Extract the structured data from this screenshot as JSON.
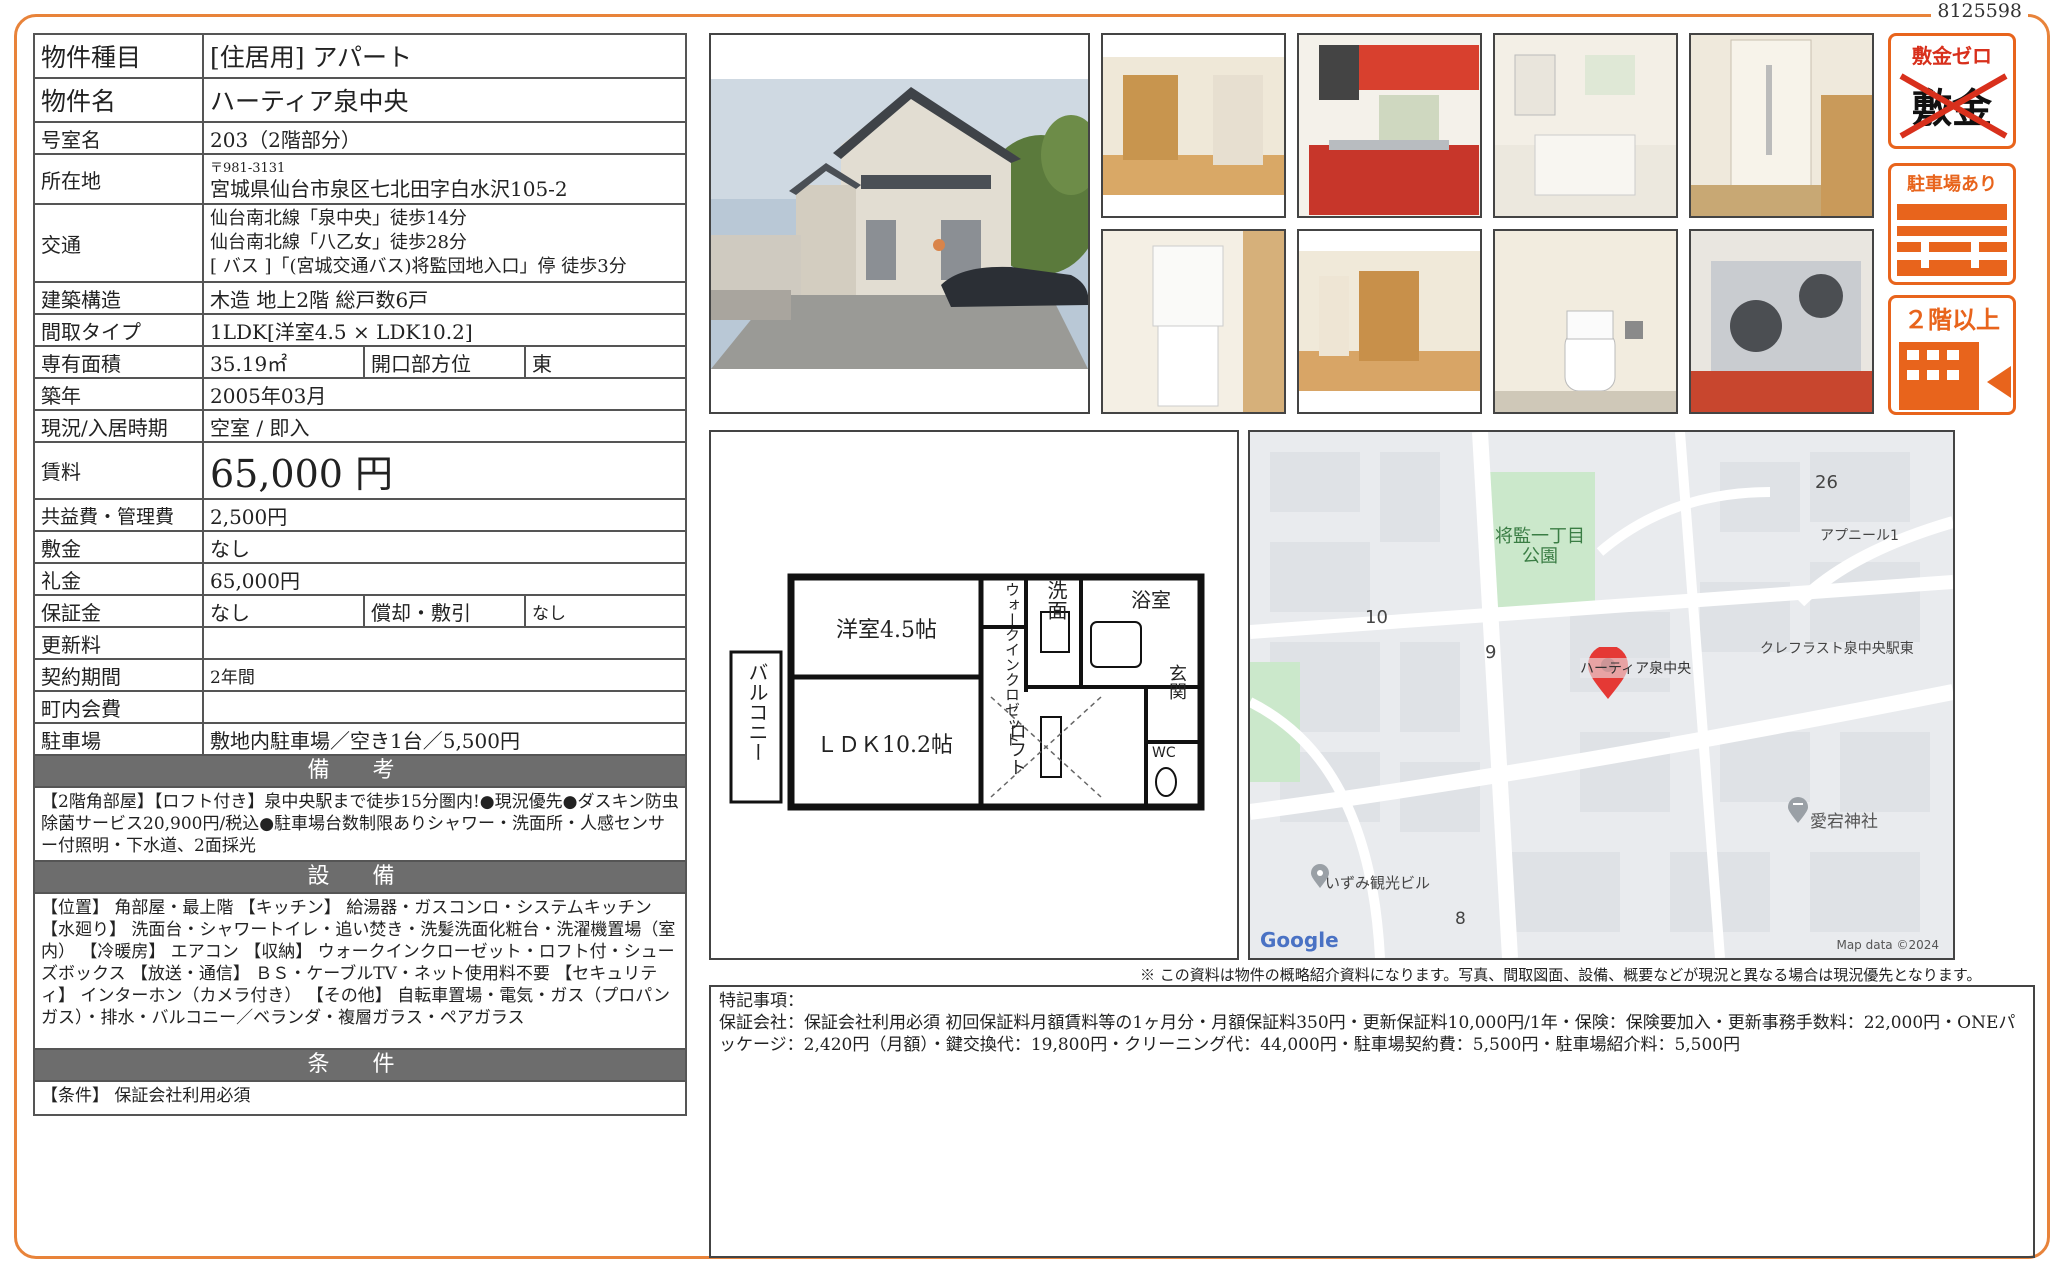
{
  "doc_id": "8125598",
  "spec": {
    "type_label": "物件種目",
    "type_value": "[住居用] アパート",
    "name_label": "物件名",
    "name_value": "ハーティア泉中央",
    "room_label": "号室名",
    "room_value": "203（2階部分）",
    "address_label": "所在地",
    "postal": "〒981-3131",
    "address": "宮城県仙台市泉区七北田字白水沢105-2",
    "transport_label": "交通",
    "transport": [
      "仙台南北線「泉中央」徒歩14分",
      "仙台南北線「八乙女」徒歩28分",
      "[ バス ]「(宮城交通バス)将監団地入口」停 徒歩3分"
    ],
    "structure_label": "建築構造",
    "structure_value": "木造 地上2階 総戸数6戸",
    "layout_label": "間取タイプ",
    "layout_value": "1LDK[洋室4.5 × LDK10.2]",
    "area_label": "専有面積",
    "area_value": "35.19㎡",
    "direction_label": "開口部方位",
    "direction_value": "東",
    "built_label": "築年",
    "built_value": "2005年03月",
    "status_label": "現況/入居時期",
    "status_value": "空室 / 即入",
    "rent_label": "賃料",
    "rent_value": "65,000 円",
    "fee_label": "共益費・管理費",
    "fee_value": "2,500円",
    "deposit_label": "敷金",
    "deposit_value": "なし",
    "keymoney_label": "礼金",
    "keymoney_value": "65,000円",
    "guarantee_label": "保証金",
    "guarantee_value": "なし",
    "amort_label": "償却・敷引",
    "amort_value": "なし",
    "renewal_label": "更新料",
    "renewal_value": "",
    "contract_label": "契約期間",
    "contract_value": "2年間",
    "assoc_label": "町内会費",
    "assoc_value": "",
    "parking_label": "駐車場",
    "parking_value": "敷地内駐車場／空き1台／5,500円"
  },
  "remarks": {
    "title": "備 考",
    "text": "【2階角部屋】【ロフト付き】泉中央駅まで徒歩15分圏内!●現況優先●ダスキン防虫除菌サービス20,900円/税込●駐車場台数制限ありシャワー・洗面所・人感センサー付照明・下水道、2面採光"
  },
  "equipment": {
    "title": "設 備",
    "text": "【位置】 角部屋・最上階 【キッチン】 給湯器・ガスコンロ・システムキッチン 【水廻り】 洗面台・シャワートイレ・追い焚き・洗髪洗面化粧台・洗濯機置場（室内） 【冷暖房】 エアコン 【収納】 ウォークインクローゼット・ロフト付・シューズボックス 【放送・通信】 ＢＳ・ケーブルTV・ネット使用料不要 【セキュリティ】 インターホン（カメラ付き） 【その他】 自転車置場・電気・ガス（プロパンガス）・排水・バルコニー／ベランダ・複層ガラス・ペアガラス"
  },
  "conditions": {
    "title": "条 件",
    "text": "【条件】 保証会社利用必須"
  },
  "badges": [
    {
      "top": "敷金ゼロ",
      "main": "敷金"
    },
    {
      "top": "駐車場あり"
    },
    {
      "top": "２階以上"
    }
  ],
  "floorplan": {
    "room1": "洋室4.5帖",
    "closet": "ウォークインクロゼット",
    "wash": "洗面",
    "bath": "浴室",
    "balcony": "バルコニー",
    "entrance": "玄関",
    "ldk": "ＬＤＫ10.2帖",
    "loft": "ロフト",
    "wc": "WC"
  },
  "map": {
    "park": "将監一丁目公園",
    "pin_label": "ハーティア泉中央",
    "label_26": "26",
    "apnir": "アプニール1",
    "cleflast": "クレフラスト泉中央駅東",
    "label_10": "10",
    "label_9": "9",
    "shrine": "愛宕神社",
    "izumi": "いずみ観光ビル",
    "label_8": "8",
    "google": "Google",
    "mapdata": "Map data ©2024"
  },
  "disclaimer": "※ この資料は物件の概略紹介資料になります。写真、間取図面、設備、概要などが現況と異なる場合は現況優先となります。",
  "special_notes": {
    "title": "特記事項：",
    "text": "保証会社：保証会社利用必須 初回保証料月額賃料等の1ヶ月分・月額保証料350円・更新保証料10,000円/1年・保険：保険要加入・更新事務手数料：22,000円・ONEパッケージ：2,420円（月額）・鍵交換代：19,800円・クリーニング代：44,000円・駐車場契約費：5,500円・駐車場紹介料：5,500円"
  }
}
